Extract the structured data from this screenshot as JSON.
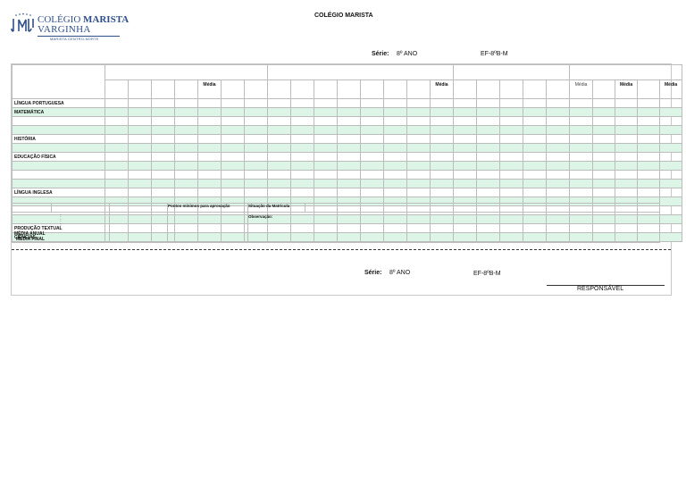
{
  "logo": {
    "line1_a": "COLÉGIO ",
    "line1_b": "MARISTA",
    "line2": "VARGINHA",
    "sub": "MARISTA CENTRO-NORTE"
  },
  "header": {
    "title": "COLÉGIO MARISTA",
    "serie_label": "Série:",
    "serie_value": "8º ANO",
    "turma": "EF-8ºB-M"
  },
  "table": {
    "media_label": "Média",
    "subjects": [
      {
        "name": "LÍNGUA PORTUGUESA",
        "green": false
      },
      {
        "name": "MATEMÁTICA",
        "green": true
      },
      {
        "name": "",
        "green": false
      },
      {
        "name": "",
        "green": true
      },
      {
        "name": "HISTÓRIA",
        "green": false
      },
      {
        "name": "",
        "green": true
      },
      {
        "name": "EDUCAÇÃO FÍSICA",
        "green": false
      },
      {
        "name": "",
        "green": true
      },
      {
        "name": "",
        "green": false
      },
      {
        "name": "",
        "green": true
      },
      {
        "name": "LÍNGUA INGLESA",
        "green": false
      },
      {
        "name": "",
        "green": true
      },
      {
        "name": "",
        "green": false
      },
      {
        "name": "",
        "green": true
      },
      {
        "name": "PRODUÇÃO TEXTUAL",
        "green": false
      },
      {
        "name": "CIÊNCIAS",
        "green": true
      }
    ]
  },
  "bottom": {
    "pontos": "Pontos mínimos para aprovação",
    "situacao": "Situação da Matrícula",
    "observacao": "Observação:",
    "dots": ":",
    "media_anual": "MÉDIA ANUAL",
    "media_final": "MÉDIA FINAL"
  },
  "footer": {
    "serie_label": "Série:",
    "serie_value": "8º ANO",
    "turma": "EF-8ºB-M",
    "responsavel": "RESPONSÁVEL"
  }
}
